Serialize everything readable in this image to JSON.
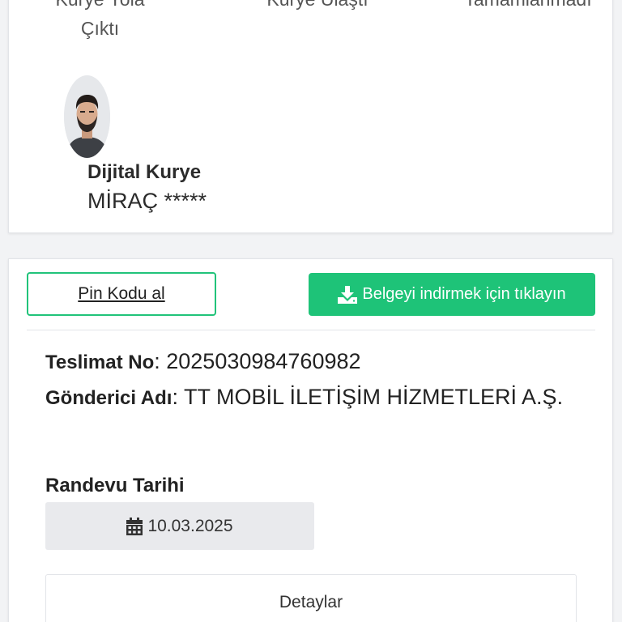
{
  "tracking": {
    "steps": [
      {
        "line1": "Kurye Yola",
        "line2": "Çıktı"
      },
      {
        "line1": "Kurye Ulaştı",
        "line2": ""
      },
      {
        "line1": "Tamamlanmadı",
        "line2": ""
      }
    ]
  },
  "courier": {
    "type": "Dijital Kurye",
    "name": "MİRAÇ *****"
  },
  "actions": {
    "pin_label": "Pin Kodu al",
    "download_label": "Belgeyi indirmek için tıklayın",
    "accent_color": "#1ec378"
  },
  "delivery": {
    "number_label": "Teslimat No",
    "number_value": ": 2025030984760982",
    "sender_label": "Gönderici Adı",
    "sender_value": ": TT MOBİL İLETİŞİM HİZMETLERİ A.Ş."
  },
  "appointment": {
    "label": "Randevu Tarihi",
    "date": "10.03.2025",
    "icon": "calendar-icon"
  },
  "details": {
    "label": "Detaylar"
  }
}
